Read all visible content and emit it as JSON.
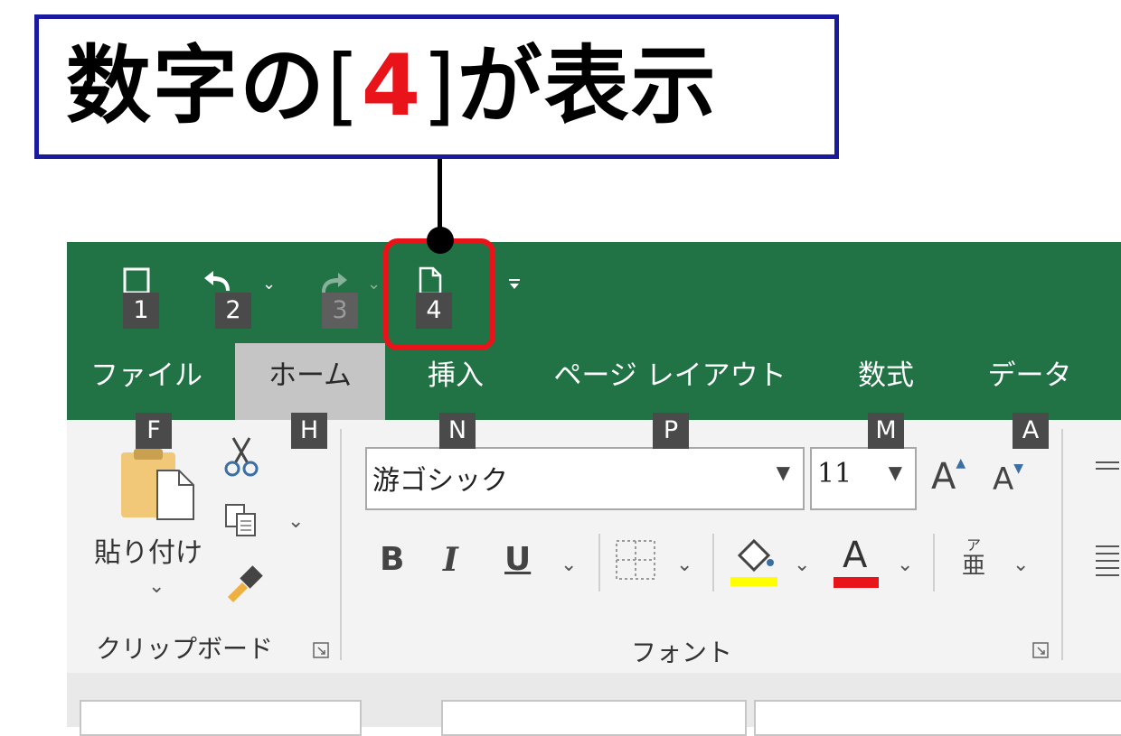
{
  "callout": {
    "prefix": "数字の",
    "open_bracket": "[",
    "number": "4",
    "close_bracket": "]",
    "suffix": "が表示"
  },
  "qat": {
    "keytips": [
      "1",
      "2",
      "3",
      "4"
    ]
  },
  "tabs": [
    {
      "label": "ファイル",
      "keytip": "F"
    },
    {
      "label": "ホーム",
      "keytip": "H",
      "active": true
    },
    {
      "label": "挿入",
      "keytip": "N"
    },
    {
      "label": "ページ レイアウト",
      "keytip": "P"
    },
    {
      "label": "数式",
      "keytip": "M"
    },
    {
      "label": "データ",
      "keytip": "A"
    }
  ],
  "clipboard": {
    "paste_label": "貼り付け",
    "group_label": "クリップボード"
  },
  "font": {
    "name": "游ゴシック",
    "size": "11",
    "group_label": "フォント",
    "bold": "B",
    "italic": "I",
    "underline": "U",
    "grow": "A",
    "shrink": "A",
    "font_color_glyph": "A",
    "phonetic_top": "ア",
    "phonetic_bottom": "亜"
  },
  "colors": {
    "ribbon_green": "#217346",
    "callout_border": "#1a1a9e",
    "highlight_red": "#e8141a",
    "fill_color_yellow": "#ffff00",
    "font_color_red": "#e8141a"
  }
}
